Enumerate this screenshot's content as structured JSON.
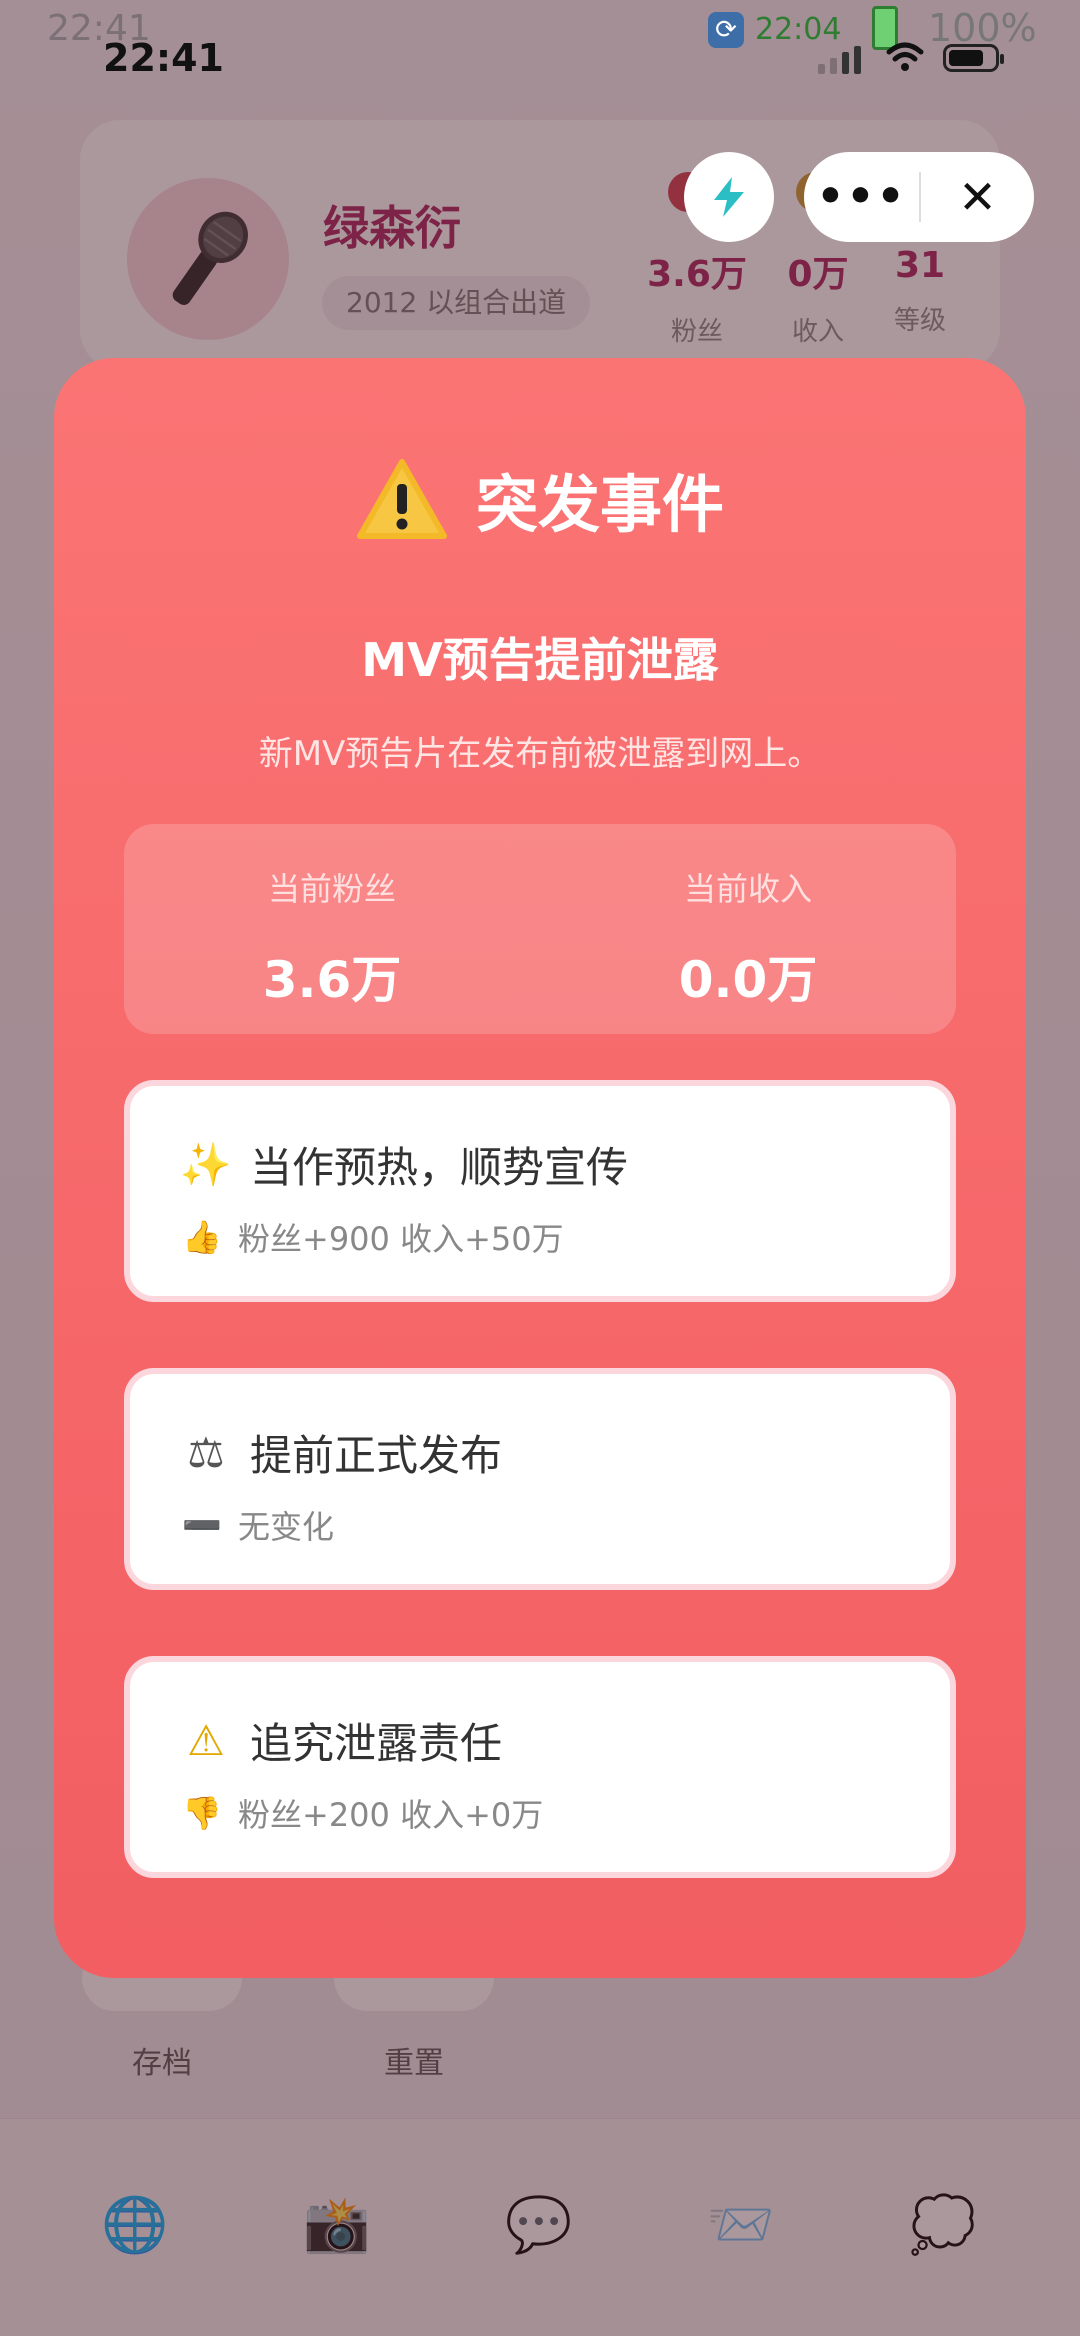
{
  "status_bar": {
    "ghost_time": "22:41",
    "time": "22:41",
    "sys_time": "22:04",
    "battery_pct": "100%"
  },
  "profile": {
    "name": "绿森衍",
    "debut": "2012 以组合出道",
    "stats": [
      {
        "value": "3.6万",
        "label": "粉丝"
      },
      {
        "value": "0万",
        "label": "收入"
      },
      {
        "value": "31",
        "label": "等级"
      }
    ]
  },
  "bottom_actions": [
    {
      "label": "存档"
    },
    {
      "label": "重置"
    }
  ],
  "tabbar": {
    "icons": [
      "globe-icon",
      "camera-flash-icon",
      "chat-bubble-icon",
      "mail-icon",
      "thought-bubble-icon"
    ]
  },
  "capsule": {
    "more": "•••",
    "close": "✕"
  },
  "modal": {
    "title": "突发事件",
    "event_name": "MV预告提前泄露",
    "event_desc": "新MV预告片在发布前被泄露到网上。",
    "current": {
      "fans_label": "当前粉丝",
      "fans_value": "3.6万",
      "income_label": "当前收入",
      "income_value": "0.0万"
    },
    "options": [
      {
        "icon": "sparkles-icon",
        "glyph": "✨",
        "title": "当作预热，顺势宣传",
        "effect_icon": "thumbs-up-icon",
        "effect_glyph": "👍",
        "effect": "粉丝+900 收入+50万"
      },
      {
        "icon": "balance-scale-icon",
        "glyph": "⚖",
        "title": "提前正式发布",
        "effect_icon": "minus-icon",
        "effect_glyph": "➖",
        "effect": "无变化"
      },
      {
        "icon": "warning-icon",
        "glyph": "⚠",
        "title": "追究泄露责任",
        "effect_icon": "thumbs-down-icon",
        "effect_glyph": "👎",
        "effect": "粉丝+200 收入+0万"
      }
    ]
  },
  "colors": {
    "modal_top": "#fb7474",
    "modal_bottom": "#f25e62",
    "name_accent": "#a8205a"
  }
}
